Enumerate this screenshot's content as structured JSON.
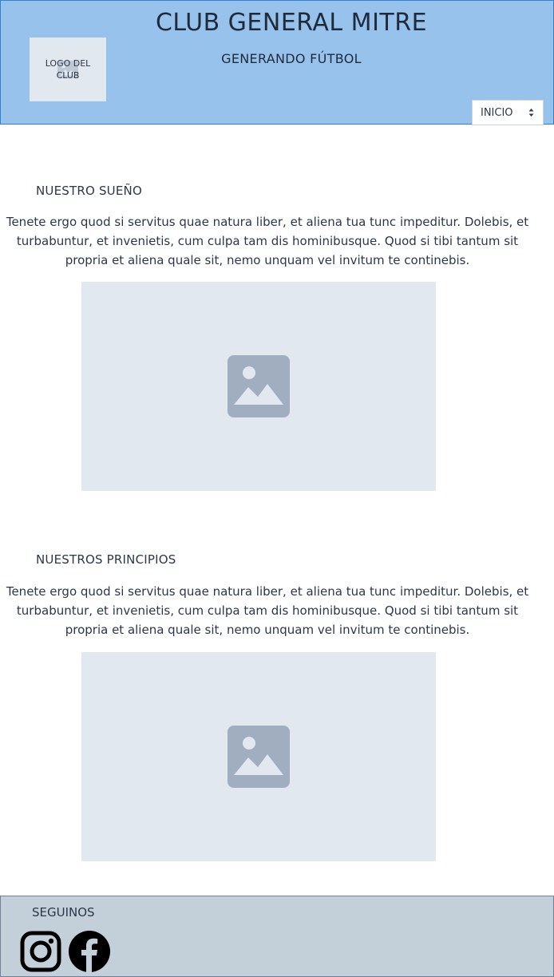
{
  "header": {
    "logo_text": "LOGO DEL CLUB",
    "title": "CLUB GENERAL MITRE",
    "subtitle": "GENERANDO FÚTBOL",
    "nav_select": {
      "selected": "INICIO"
    }
  },
  "sections": [
    {
      "heading": "NUESTRO SUEÑO",
      "text": "Tenete ergo quod si servitus quae natura liber, et aliena tua tunc impeditur. Dolebis, et turbabuntur, et invenietis, cum culpa tam dis hominibusque. Quod si tibi tantum sit propria et aliena quale sit, nemo unquam vel invitum te continebis.",
      "image_icon": "image-placeholder-icon"
    },
    {
      "heading": "NUESTROS PRINCIPIOS",
      "text": "Tenete ergo quod si servitus quae natura liber, et aliena tua tunc impeditur. Dolebis, et turbabuntur, et invenietis, cum culpa tam dis hominibusque. Quod si tibi tantum sit propria et aliena quale sit, nemo unquam vel invitum te continebis.",
      "image_icon": "image-placeholder-icon"
    }
  ],
  "footer": {
    "title": "SEGUINOS",
    "social": [
      {
        "icon": "instagram-icon"
      },
      {
        "icon": "facebook-icon"
      }
    ]
  },
  "colors": {
    "header_bg": "#96c2ec",
    "header_border": "#3182ce",
    "placeholder_bg": "#e2e8f0",
    "placeholder_icon": "#a0aec0",
    "footer_bg": "#c3d0da",
    "text": "#2d3748"
  }
}
